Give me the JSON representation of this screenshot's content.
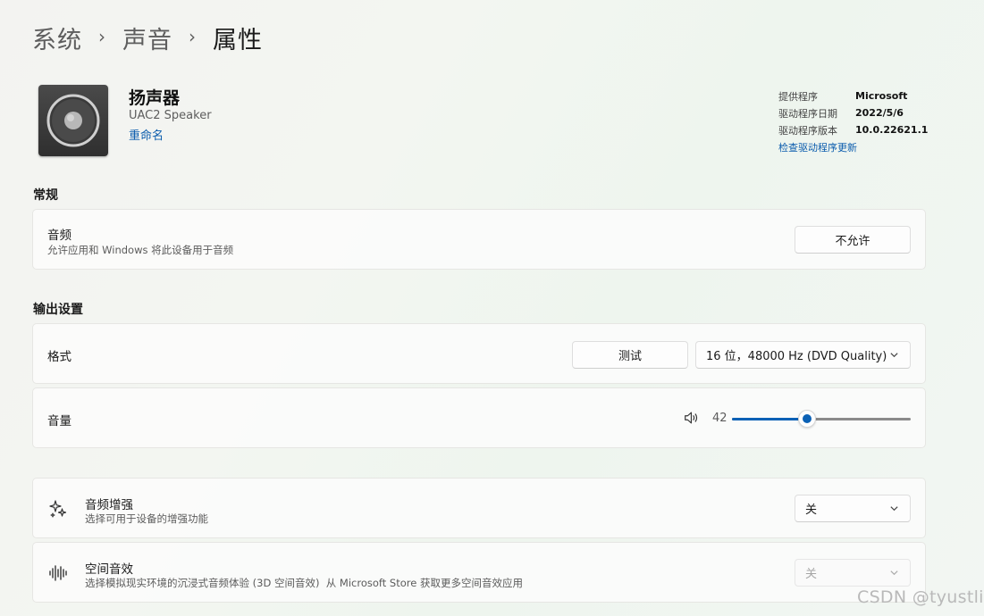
{
  "breadcrumb": {
    "item1": "系统",
    "item2": "声音",
    "current": "属性",
    "separator": "›"
  },
  "device": {
    "name": "扬声器",
    "model": "UAC2 Speaker",
    "rename": "重命名",
    "icon": "speaker-device-icon"
  },
  "driver": {
    "provider_label": "提供程序",
    "provider_value": "Microsoft",
    "date_label": "驱动程序日期",
    "date_value": "2022/5/6",
    "version_label": "驱动程序版本",
    "version_value": "10.0.22621.1",
    "update_link": "检查驱动程序更新"
  },
  "general": {
    "section_title": "常规",
    "audio": {
      "title": "音频",
      "subtitle": "允许应用和 Windows 将此设备用于音频",
      "button": "不允许"
    }
  },
  "output": {
    "section_title": "输出设置",
    "format": {
      "title": "格式",
      "test_button": "测试",
      "selected": "16 位，48000 Hz (DVD Quality)"
    },
    "volume": {
      "title": "音量",
      "value": "42",
      "percent": 42
    }
  },
  "enhancements": {
    "title": "音频增强",
    "subtitle": "选择可用于设备的增强功能",
    "selected": "关",
    "icon": "sparkle-icon"
  },
  "spatial": {
    "title": "空间音效",
    "subtitle": "选择模拟现实环境的沉浸式音频体验 (3D 空间音效)  从 Microsoft Store 获取更多空间音效应用",
    "selected": "关",
    "icon": "sound-wave-icon"
  },
  "watermark": "CSDN @tyustli",
  "colors": {
    "accent": "#0b61b5",
    "link": "#0b5cad"
  }
}
